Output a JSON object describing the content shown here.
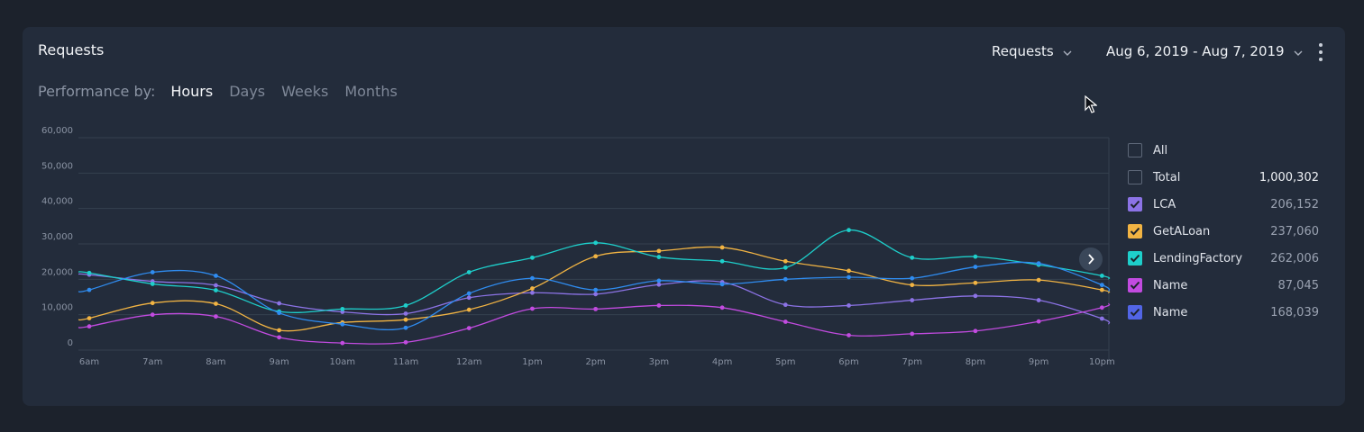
{
  "widget": {
    "title": "Requests"
  },
  "performance": {
    "label": "Performance by:",
    "tabs": [
      {
        "label": "Hours",
        "active": true
      },
      {
        "label": "Days",
        "active": false
      },
      {
        "label": "Weeks",
        "active": false
      },
      {
        "label": "Months",
        "active": false
      }
    ]
  },
  "controls": {
    "metric": "Requests",
    "date_range": "Aug 6, 2019 - Aug 7, 2019"
  },
  "legend": {
    "items": [
      {
        "label": "All",
        "value": "",
        "checked": false,
        "color": ""
      },
      {
        "label": "Total",
        "value": "1,000,302",
        "checked": false,
        "color": ""
      },
      {
        "label": "LCA",
        "value": "206,152",
        "checked": true,
        "color": "#8c73e6"
      },
      {
        "label": "GetALoan",
        "value": "237,060",
        "checked": true,
        "color": "#f2b443"
      },
      {
        "label": "LendingFactory",
        "value": "262,006",
        "checked": true,
        "color": "#1ecfcb"
      },
      {
        "label": "Name",
        "value": "87,045",
        "checked": true,
        "color": "#c24be0"
      },
      {
        "label": "Name",
        "value": "168,039",
        "checked": true,
        "color": "#5265e6"
      }
    ]
  },
  "chart_data": {
    "type": "line",
    "categories": [
      "6am",
      "7am",
      "8am",
      "9am",
      "10am",
      "11am",
      "12am",
      "1pm",
      "2pm",
      "3pm",
      "4pm",
      "5pm",
      "6pm",
      "7pm",
      "8pm",
      "9pm",
      "10pm"
    ],
    "ylim": [
      0,
      60000
    ],
    "yticks": [
      "0",
      "10,000",
      "20,000",
      "30,000",
      "40,000",
      "50,000",
      "60,000"
    ],
    "grid": true,
    "series": [
      {
        "name": "LCA",
        "color": "#8c73e6",
        "values": [
          21300,
          19400,
          18300,
          13200,
          10800,
          10300,
          14800,
          16200,
          15800,
          18500,
          19200,
          12800,
          12600,
          14100,
          15300,
          14100,
          8900
        ]
      },
      {
        "name": "GetALoan",
        "color": "#f2b443",
        "values": [
          9000,
          13300,
          13100,
          5600,
          7800,
          8600,
          11400,
          17400,
          26500,
          28000,
          29000,
          25100,
          22400,
          18400,
          19000,
          19800,
          17000
        ]
      },
      {
        "name": "LendingFactory",
        "color": "#1ecfcb",
        "values": [
          21800,
          18700,
          16900,
          10900,
          11600,
          12600,
          22000,
          26100,
          30300,
          26300,
          25100,
          23300,
          33900,
          26100,
          26400,
          24100,
          21000
        ]
      },
      {
        "name": "Name",
        "color": "#c24be0",
        "values": [
          6700,
          10000,
          9500,
          3600,
          2000,
          2200,
          6200,
          11700,
          11600,
          12600,
          12000,
          8000,
          4200,
          4600,
          5400,
          8100,
          12000
        ]
      },
      {
        "name": "Name",
        "color": "#2f8cf0",
        "values": [
          17000,
          22000,
          21000,
          10500,
          7300,
          6300,
          16000,
          20300,
          17000,
          19600,
          18600,
          20000,
          20600,
          20300,
          23500,
          24500,
          18400
        ]
      }
    ]
  }
}
